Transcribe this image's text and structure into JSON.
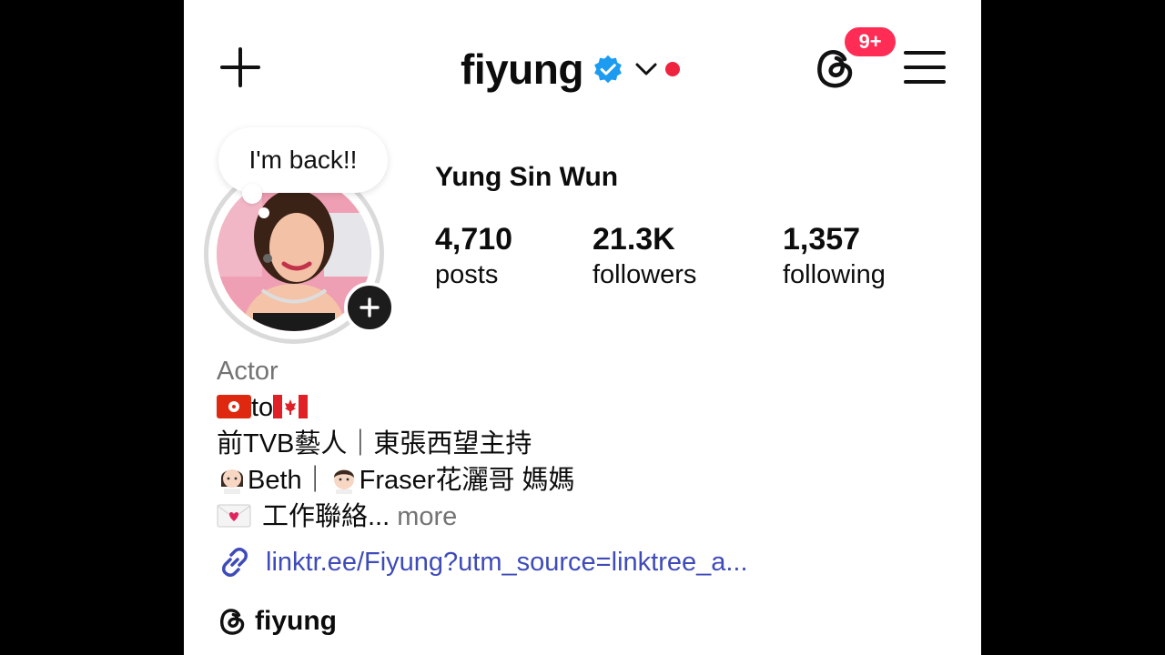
{
  "header": {
    "username": "fiyung",
    "notification_badge": "9+",
    "icons": [
      "plus-icon",
      "verified-badge-icon",
      "chevron-down-icon",
      "threads-icon",
      "menu-icon"
    ]
  },
  "profile": {
    "note": "I'm back!!",
    "full_name": "Yung Sin Wun",
    "stats": [
      {
        "value": "4,710",
        "label": "posts"
      },
      {
        "value": "21.3K",
        "label": "followers"
      },
      {
        "value": "1,357",
        "label": "following"
      }
    ]
  },
  "bio": {
    "category": "Actor",
    "line1_text": "to",
    "line2": "前TVB藝人｜東張西望主持",
    "line3_a": "Beth｜",
    "line3_b": "Fraser花灑哥 媽媽",
    "line4": "工作聯絡...",
    "more": "more"
  },
  "link": {
    "text": "linktr.ee/Fiyung?utm_source=linktree_a..."
  },
  "threads_link": {
    "text": "fiyung"
  },
  "colors": {
    "verified": "#1d9bf0",
    "badge": "#ff2d55",
    "link": "#3e4bb8",
    "muted": "#737373"
  }
}
